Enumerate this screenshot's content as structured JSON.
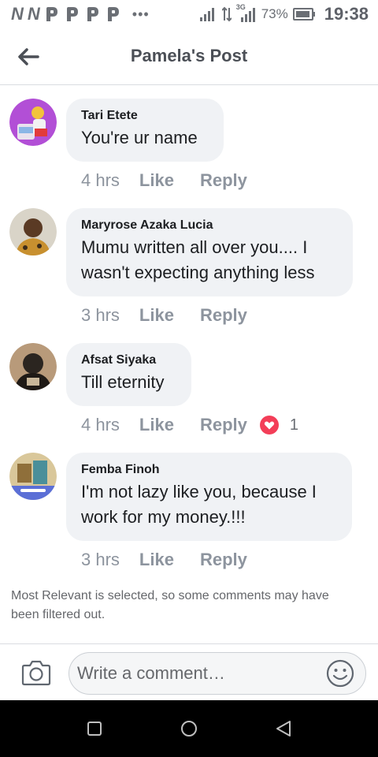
{
  "status_bar": {
    "left_icons": [
      "N",
      "N"
    ],
    "network": "3G",
    "battery_percent": "73%",
    "time": "19:38"
  },
  "header": {
    "title": "Pamela's Post",
    "back_icon": "arrow-left-icon"
  },
  "comments": [
    {
      "name": "Tari Etete",
      "text": "You're ur name",
      "time": "4 hrs",
      "like_label": "Like",
      "reply_label": "Reply"
    },
    {
      "name": "Maryrose Azaka Lucia",
      "text": "Mumu written all over you.... I wasn't expecting anything less",
      "time": "3 hrs",
      "like_label": "Like",
      "reply_label": "Reply"
    },
    {
      "name": "Afsat Siyaka",
      "text": "Till eternity",
      "time": "4 hrs",
      "like_label": "Like",
      "reply_label": "Reply",
      "reaction_count": "1",
      "reaction_icon": "love-reaction-icon"
    },
    {
      "name": "Femba Finoh",
      "text": "I'm not lazy like you, because I work for my money.!!!",
      "time": "3 hrs",
      "like_label": "Like",
      "reply_label": "Reply"
    }
  ],
  "filter_note": "Most Relevant is selected, so some comments may have been filtered out.",
  "composer": {
    "placeholder": "Write a comment…",
    "camera_icon": "camera-icon",
    "emoji_icon": "smiley-icon"
  },
  "colors": {
    "bubble": "#f0f2f5",
    "meta_text": "#8d949e",
    "love_red": "#f33e58"
  }
}
